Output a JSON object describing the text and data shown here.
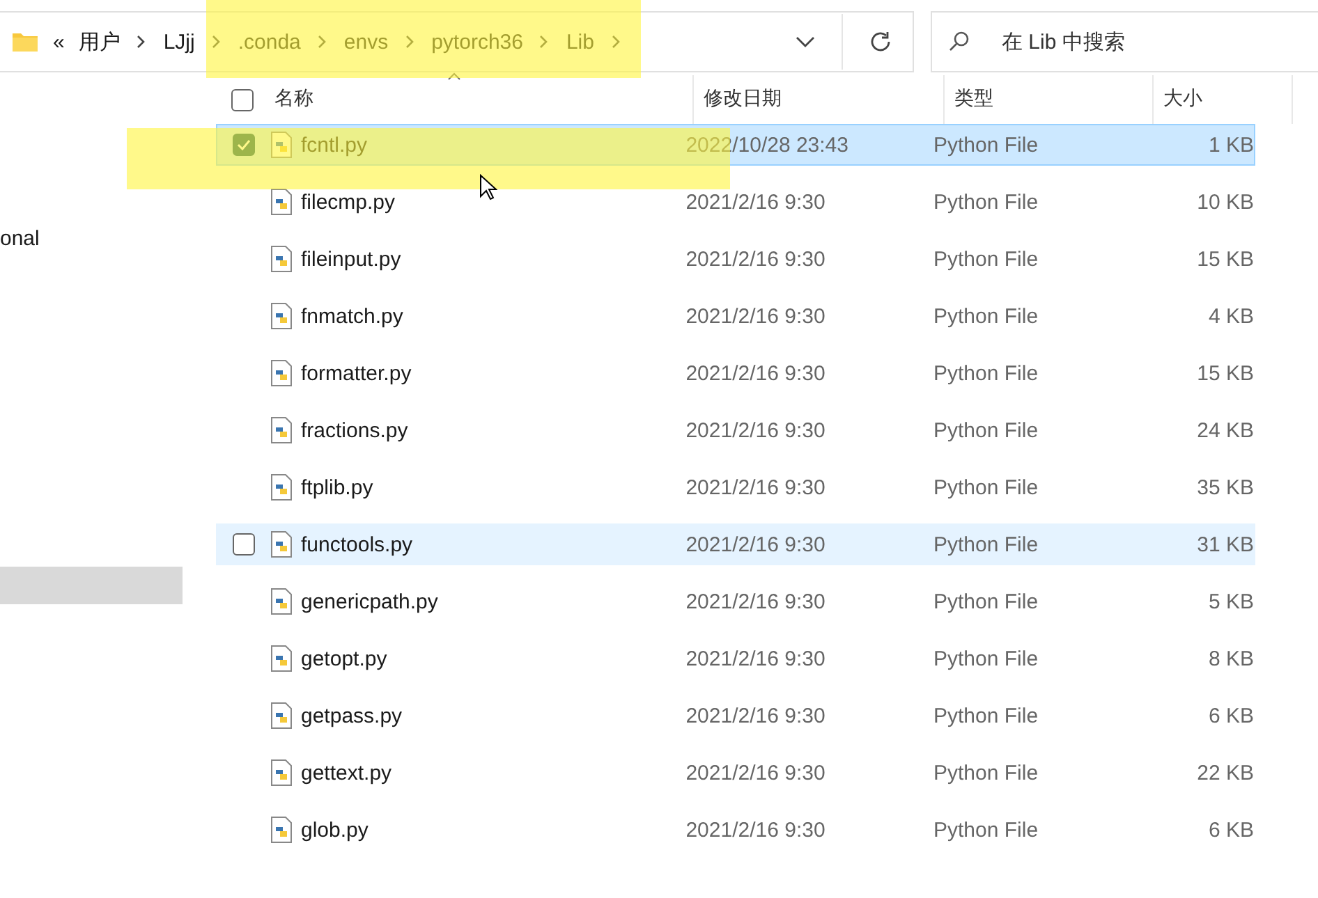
{
  "address_bar": {
    "overflow": "«",
    "path": [
      {
        "label": "用户"
      },
      {
        "label": "LJjj"
      },
      {
        "label": ".conda"
      },
      {
        "label": "envs"
      },
      {
        "label": "pytorch36"
      },
      {
        "label": "Lib"
      }
    ]
  },
  "search": {
    "placeholder": "在 Lib 中搜索"
  },
  "navigation": {
    "items": [
      {
        "label": "onal",
        "selected": false
      },
      {
        "selected": true
      }
    ]
  },
  "select_all": {
    "checked": false
  },
  "columns": [
    {
      "label": "名称",
      "sorted": true
    },
    {
      "label": "修改日期",
      "sorted": false
    },
    {
      "label": "类型",
      "sorted": false
    },
    {
      "label": "大小",
      "sorted": false
    }
  ],
  "files": [
    {
      "name": "fcntl.py",
      "modified": "2022/10/28 23:43",
      "type": "Python File",
      "size": "1 KB",
      "selected": true,
      "hovered": false
    },
    {
      "name": "filecmp.py",
      "modified": "2021/2/16 9:30",
      "type": "Python File",
      "size": "10 KB",
      "selected": false,
      "hovered": false
    },
    {
      "name": "fileinput.py",
      "modified": "2021/2/16 9:30",
      "type": "Python File",
      "size": "15 KB",
      "selected": false,
      "hovered": false
    },
    {
      "name": "fnmatch.py",
      "modified": "2021/2/16 9:30",
      "type": "Python File",
      "size": "4 KB",
      "selected": false,
      "hovered": false
    },
    {
      "name": "formatter.py",
      "modified": "2021/2/16 9:30",
      "type": "Python File",
      "size": "15 KB",
      "selected": false,
      "hovered": false
    },
    {
      "name": "fractions.py",
      "modified": "2021/2/16 9:30",
      "type": "Python File",
      "size": "24 KB",
      "selected": false,
      "hovered": false
    },
    {
      "name": "ftplib.py",
      "modified": "2021/2/16 9:30",
      "type": "Python File",
      "size": "35 KB",
      "selected": false,
      "hovered": false
    },
    {
      "name": "functools.py",
      "modified": "2021/2/16 9:30",
      "type": "Python File",
      "size": "31 KB",
      "selected": false,
      "hovered": true
    },
    {
      "name": "genericpath.py",
      "modified": "2021/2/16 9:30",
      "type": "Python File",
      "size": "5 KB",
      "selected": false,
      "hovered": false
    },
    {
      "name": "getopt.py",
      "modified": "2021/2/16 9:30",
      "type": "Python File",
      "size": "8 KB",
      "selected": false,
      "hovered": false
    },
    {
      "name": "getpass.py",
      "modified": "2021/2/16 9:30",
      "type": "Python File",
      "size": "6 KB",
      "selected": false,
      "hovered": false
    },
    {
      "name": "gettext.py",
      "modified": "2021/2/16 9:30",
      "type": "Python File",
      "size": "22 KB",
      "selected": false,
      "hovered": false
    },
    {
      "name": "glob.py",
      "modified": "2021/2/16 9:30",
      "type": "Python File",
      "size": "6 KB",
      "selected": false,
      "hovered": false
    }
  ]
}
